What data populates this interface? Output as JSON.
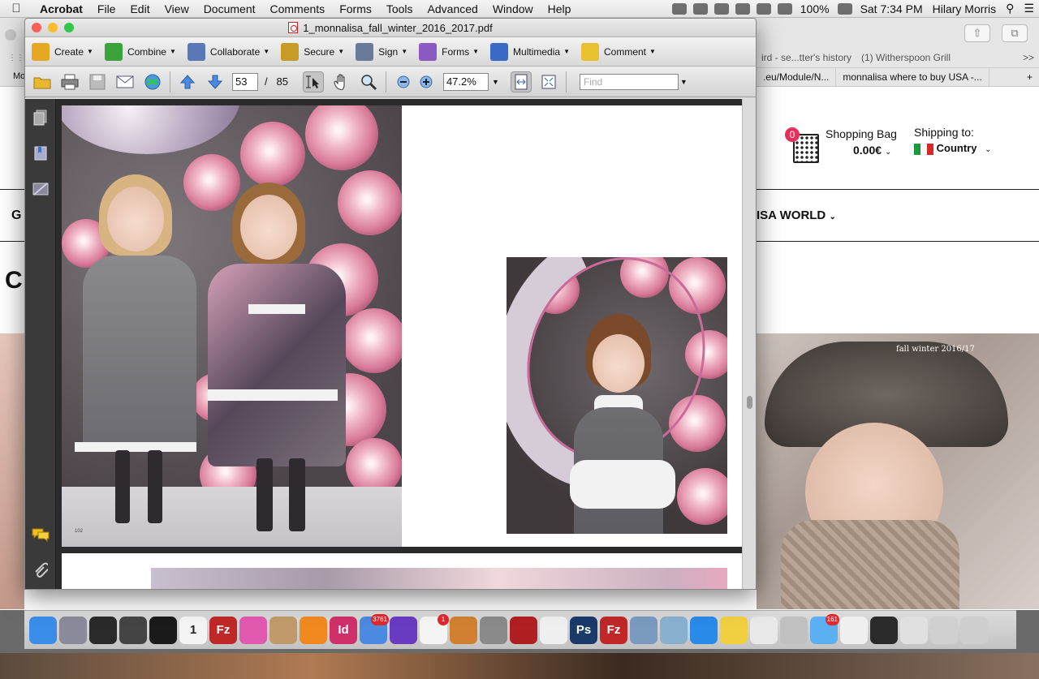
{
  "menubar": {
    "apple_icon": "apple-icon",
    "app_name": "Acrobat",
    "items": [
      "File",
      "Edit",
      "View",
      "Document",
      "Comments",
      "Forms",
      "Tools",
      "Advanced",
      "Window",
      "Help"
    ],
    "battery": "100%",
    "clock": "Sat 7:34 PM",
    "user": "Hilary Morris"
  },
  "browser": {
    "tabs_row1": [
      "ird - se...tter's history",
      "(1) Witherspoon Grill"
    ],
    "tabs_row2": [
      ".eu/Module/N...",
      "monnalisa where to buy USA -..."
    ],
    "bookmark_left": "Mo",
    "overflow": ">>",
    "add_tab": "+"
  },
  "site": {
    "bag_count": "0",
    "bag_label": "Shopping Bag",
    "bag_total": "0.00€",
    "ship_label": "Shipping to:",
    "ship_country": "Country",
    "nav_first": "G",
    "nav_world": "ISA WORLD",
    "heading_fragment": "C",
    "hero_caption": "fall winter 2016/17"
  },
  "acrobat": {
    "title": "1_monnalisa_fall_winter_2016_2017.pdf",
    "tasks": [
      {
        "label": "Create",
        "icon": "create-icon",
        "color": "#e6a820"
      },
      {
        "label": "Combine",
        "icon": "combine-icon",
        "color": "#3aa43a"
      },
      {
        "label": "Collaborate",
        "icon": "collaborate-icon",
        "color": "#5a78b8"
      },
      {
        "label": "Secure",
        "icon": "secure-lock-icon",
        "color": "#c89a28"
      },
      {
        "label": "Sign",
        "icon": "sign-pen-icon",
        "color": "#6a7a9a"
      },
      {
        "label": "Forms",
        "icon": "forms-icon",
        "color": "#8a5ac0"
      },
      {
        "label": "Multimedia",
        "icon": "multimedia-icon",
        "color": "#3a6ac8"
      },
      {
        "label": "Comment",
        "icon": "comment-icon",
        "color": "#e8c030"
      }
    ],
    "toolbar": {
      "current_page": "53",
      "page_separator": "/",
      "total_pages": "85",
      "zoom": "47.2%",
      "find_placeholder": "Find"
    },
    "page_footer_number": "102"
  },
  "dock": {
    "items": [
      {
        "icon": "finder-icon",
        "color": "#3a8ee8"
      },
      {
        "icon": "launchpad-icon",
        "color": "#8a8a9a"
      },
      {
        "icon": "mission-control-icon",
        "color": "#2a2a2a"
      },
      {
        "icon": "imovie-icon",
        "color": "#444"
      },
      {
        "icon": "dashboard-icon",
        "color": "#1a1a1a"
      },
      {
        "icon": "calendar-icon",
        "color": "#f4f4f4",
        "text": "1",
        "textColor": "#222"
      },
      {
        "icon": "filezilla-icon",
        "color": "#c02828",
        "text": "Fz"
      },
      {
        "icon": "itunes-icon",
        "color": "#e05ab0"
      },
      {
        "icon": "contacts-icon",
        "color": "#c09a6a"
      },
      {
        "icon": "ibooks-icon",
        "color": "#f08a20"
      },
      {
        "icon": "indesign-icon",
        "color": "#d0306a",
        "text": "Id"
      },
      {
        "icon": "mail-icon",
        "color": "#4a8ae0",
        "badge": "3761"
      },
      {
        "icon": "imovie-star-icon",
        "color": "#6a3ac0"
      },
      {
        "icon": "photos-icon",
        "color": "#f4f4f4",
        "badge": "1"
      },
      {
        "icon": "garageband-icon",
        "color": "#d08030"
      },
      {
        "icon": "calculator-icon",
        "color": "#8a8a8a"
      },
      {
        "icon": "photo-booth-icon",
        "color": "#b02020"
      },
      {
        "icon": "textedit-icon",
        "color": "#f0f0f0"
      },
      {
        "icon": "photoshop-icon",
        "color": "#1a3a6a",
        "text": "Ps"
      },
      {
        "icon": "filezilla-icon-2",
        "color": "#c02828",
        "text": "Fz"
      },
      {
        "icon": "preview-icon",
        "color": "#7a9ac0"
      },
      {
        "icon": "image-capture-icon",
        "color": "#8ab0d0"
      },
      {
        "icon": "safari-icon",
        "color": "#2a8ae8"
      },
      {
        "icon": "notes-icon",
        "color": "#f0d040"
      },
      {
        "icon": "game-center-icon",
        "color": "#e8e8e8"
      },
      {
        "icon": "keychain-icon",
        "color": "#c0c0c0"
      },
      {
        "icon": "messages-icon",
        "color": "#5ab0f0",
        "badge": "161"
      },
      {
        "icon": "acrobat-icon",
        "color": "#f0f0f0"
      },
      {
        "icon": "folder-stack-icon",
        "color": "#2a2a2a"
      },
      {
        "icon": "documents-stack-icon",
        "color": "#e0e0e0"
      },
      {
        "icon": "downloads-stack-icon",
        "color": "#d0d0d0"
      },
      {
        "icon": "trash-icon",
        "color": "#cfcfcf"
      }
    ]
  }
}
